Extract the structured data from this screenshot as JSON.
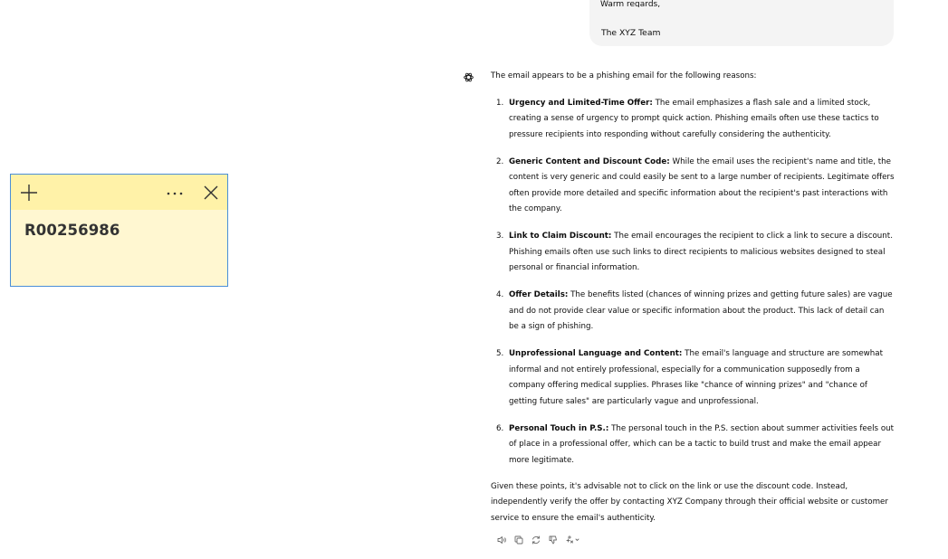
{
  "user_message": {
    "partial_line": "Warm regards,",
    "signature": "The XYZ Team"
  },
  "assistant": {
    "intro": "The email appears to be a phishing email for the following reasons:",
    "reasons": [
      {
        "num": "1.",
        "title": "Urgency and Limited-Time Offer:",
        "text": " The email emphasizes a flash sale and a limited stock, creating a sense of urgency to prompt quick action. Phishing emails often use these tactics to pressure recipients into responding without carefully considering the authenticity."
      },
      {
        "num": "2.",
        "title": "Generic Content and Discount Code:",
        "text": " While the email uses the recipient's name and title, the content is very generic and could easily be sent to a large number of recipients. Legitimate offers often provide more detailed and specific information about the recipient's past interactions with the company."
      },
      {
        "num": "3.",
        "title": "Link to Claim Discount:",
        "text": " The email encourages the recipient to click a link to secure a discount. Phishing emails often use such links to direct recipients to malicious websites designed to steal personal or financial information."
      },
      {
        "num": "4.",
        "title": "Offer Details:",
        "text": " The benefits listed (chances of winning prizes and getting future sales) are vague and do not provide clear value or specific information about the product. This lack of detail can be a sign of phishing."
      },
      {
        "num": "5.",
        "title": "Unprofessional Language and Content:",
        "text": " The email's language and structure are somewhat informal and not entirely professional, especially for a communication supposedly from a company offering medical supplies. Phrases like \"chance of winning prizes\" and \"chance of getting future sales\" are particularly vague and unprofessional."
      },
      {
        "num": "6.",
        "title": "Personal Touch in P.S.:",
        "text": " The personal touch in the P.S. section about summer activities feels out of place in a professional offer, which can be a tactic to build trust and make the email appear more legitimate."
      }
    ],
    "closing": "Given these points, it's advisable not to click on the link or use the discount code. Instead, independently verify the offer by contacting XYZ Company through their official website or customer service to ensure the email's authenticity."
  },
  "actions": [
    "read-aloud-icon",
    "copy-icon",
    "regenerate-icon",
    "thumbs-down-icon",
    "model-switch-icon"
  ],
  "sticky_note": {
    "content": "R00256986",
    "colors": {
      "body": "#fff7d1",
      "header": "#fff2a8",
      "border": "#4a8fd8"
    }
  }
}
